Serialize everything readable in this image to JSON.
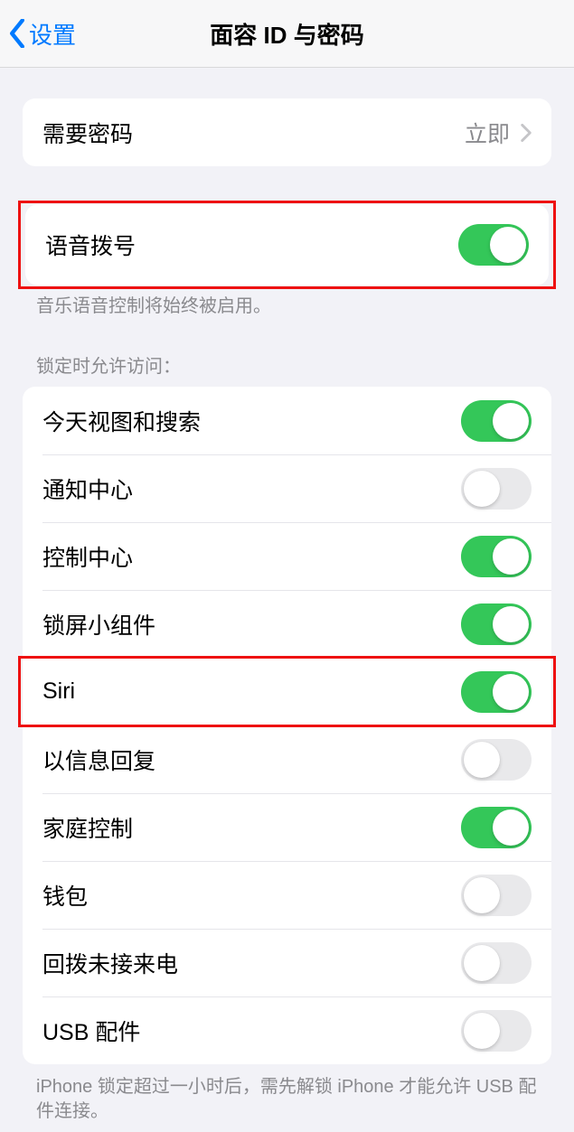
{
  "header": {
    "back_label": "设置",
    "title": "面容 ID 与密码"
  },
  "passcode": {
    "require_label": "需要密码",
    "require_value": "立即"
  },
  "voice_dial": {
    "label": "语音拨号",
    "on": true,
    "footer": "音乐语音控制将始终被启用。"
  },
  "locked_header": "锁定时允许访问：",
  "locked_items": [
    {
      "label": "今天视图和搜索",
      "on": true
    },
    {
      "label": "通知中心",
      "on": false
    },
    {
      "label": "控制中心",
      "on": true
    },
    {
      "label": "锁屏小组件",
      "on": true
    },
    {
      "label": "Siri",
      "on": true
    },
    {
      "label": "以信息回复",
      "on": false
    },
    {
      "label": "家庭控制",
      "on": true
    },
    {
      "label": "钱包",
      "on": false
    },
    {
      "label": "回拨未接来电",
      "on": false
    },
    {
      "label": "USB 配件",
      "on": false
    }
  ],
  "usb_footer": "iPhone 锁定超过一小时后，需先解锁 iPhone 才能允许 USB 配件连接。"
}
